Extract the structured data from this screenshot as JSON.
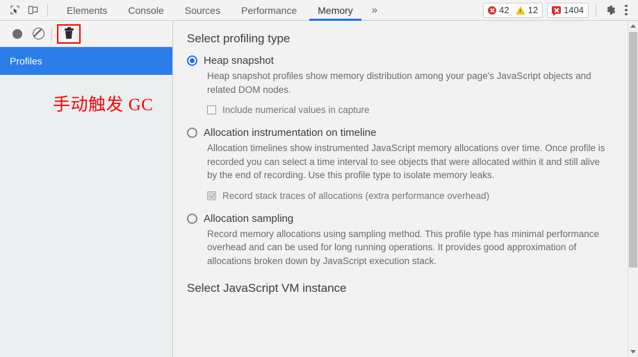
{
  "toolbar": {
    "inspect_icon": "inspect-cursor-icon",
    "device_icon": "device-toolbar-icon",
    "tabs": [
      {
        "label": "Elements",
        "active": false
      },
      {
        "label": "Console",
        "active": false
      },
      {
        "label": "Sources",
        "active": false
      },
      {
        "label": "Performance",
        "active": false
      },
      {
        "label": "Memory",
        "active": true
      }
    ],
    "more_tabs_label": "»",
    "badges": {
      "errors": "42",
      "warnings": "12",
      "messages": "1404"
    },
    "settings_icon": "gear-icon",
    "menu_icon": "kebab-menu-icon",
    "accent_color": "#1a73e8",
    "error_color": "#d93025",
    "warning_color": "#f5c518"
  },
  "sidebar": {
    "record_icon": "record-circle-icon",
    "clear_icon": "clear-no-entry-icon",
    "gc_icon": "trash-collect-garbage-icon",
    "gc_highlight_color": "#ff0000",
    "selected_item": "Profiles",
    "selected_color": "#2b7de9",
    "annotation": "手动触发 GC",
    "annotation_color": "#ff0000"
  },
  "main": {
    "heading": "Select profiling type",
    "options": [
      {
        "label": "Heap snapshot",
        "selected": true,
        "description": "Heap snapshot profiles show memory distribution among your page's JavaScript objects and related DOM nodes.",
        "checkbox": {
          "label": "Include numerical values in capture",
          "checked": false
        }
      },
      {
        "label": "Allocation instrumentation on timeline",
        "selected": false,
        "description": "Allocation timelines show instrumented JavaScript memory allocations over time. Once profile is recorded you can select a time interval to see objects that were allocated within it and still alive by the end of recording. Use this profile type to isolate memory leaks.",
        "checkbox": {
          "label": "Record stack traces of allocations (extra performance overhead)",
          "checked": true
        }
      },
      {
        "label": "Allocation sampling",
        "selected": false,
        "description": "Record memory allocations using sampling method. This profile type has minimal performance overhead and can be used for long running operations. It provides good approximation of allocations broken down by JavaScript execution stack.",
        "checkbox": null
      }
    ],
    "vm_heading": "Select JavaScript VM instance"
  },
  "scrollbar": {
    "up_icon": "scroll-up-arrow-icon",
    "down_icon": "scroll-down-arrow-icon"
  }
}
